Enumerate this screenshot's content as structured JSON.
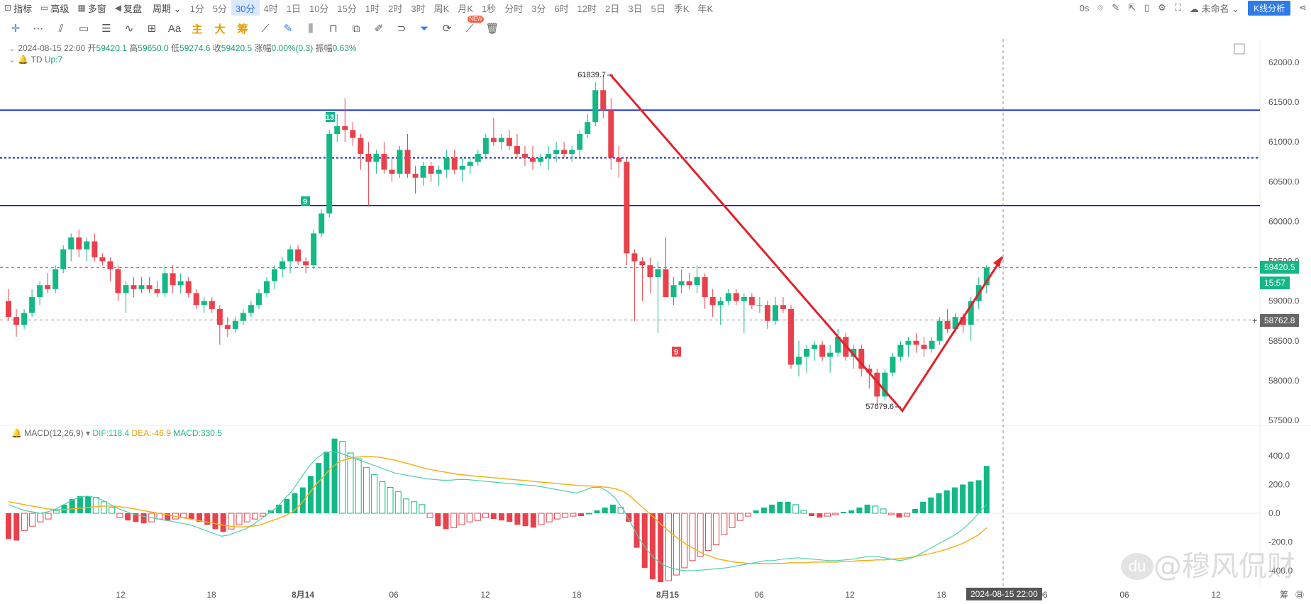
{
  "toolbar": {
    "left": [
      {
        "icon": "indicator-icon",
        "glyph": "⊡",
        "label": "指标"
      },
      {
        "icon": "advanced-icon",
        "glyph": "▭",
        "label": "高级"
      },
      {
        "icon": "multi-window-icon",
        "glyph": "▦",
        "label": "多窗"
      },
      {
        "icon": "replay-icon",
        "glyph": "◀",
        "label": "复盘"
      },
      {
        "icon": "chevron-down-icon",
        "glyph": "",
        "label": "周期 ⌄"
      }
    ],
    "periods": [
      "1分",
      "5分",
      "30分",
      "4时",
      "1日",
      "10分",
      "15分",
      "1时",
      "2时",
      "3时",
      "周K",
      "月K",
      "1秒",
      "分时",
      "3分",
      "6时",
      "12时",
      "2日",
      "3日",
      "5日",
      "季K",
      "年K"
    ],
    "active_period": "30分",
    "right": {
      "latency": "0s",
      "layout_name": "未命名",
      "kline_button": "K线分析"
    }
  },
  "tools": [
    {
      "name": "crosshair-icon",
      "glyph": "✛",
      "hl": true
    },
    {
      "name": "line-tools-icon",
      "glyph": "⋯"
    },
    {
      "name": "parallel-lines-icon",
      "glyph": "⫽"
    },
    {
      "name": "rectangle-icon",
      "glyph": "▭"
    },
    {
      "name": "horizontal-lines-icon",
      "glyph": "☰"
    },
    {
      "name": "wave-icon",
      "glyph": "∿"
    },
    {
      "name": "measure-icon",
      "glyph": "⊞"
    },
    {
      "name": "text-icon",
      "glyph": "Aa"
    },
    {
      "name": "main-force-icon",
      "glyph": "主",
      "zh": true,
      "color": "#e0a000"
    },
    {
      "name": "large-order-icon",
      "glyph": "大",
      "zh": true,
      "color": "#e0a000"
    },
    {
      "name": "chip-icon",
      "glyph": "筹",
      "zh": true,
      "color": "#e0a000"
    },
    {
      "name": "ruler-icon",
      "glyph": "⟋"
    },
    {
      "name": "pen-icon",
      "glyph": "✎",
      "hl": true
    },
    {
      "name": "candle-icon",
      "glyph": "⫼"
    },
    {
      "name": "lock-icon",
      "glyph": "⊓"
    },
    {
      "name": "copy-icon",
      "glyph": "⧉"
    },
    {
      "name": "edit-icon",
      "glyph": "✐"
    },
    {
      "name": "magnet-icon",
      "glyph": "⊃"
    },
    {
      "name": "filter-icon",
      "glyph": "⏷",
      "hl": true
    },
    {
      "name": "sync-icon",
      "glyph": "⟳"
    },
    {
      "name": "drawing-new-icon",
      "glyph": "⟋",
      "badge": "NEW"
    },
    {
      "name": "trash-icon",
      "glyph": "🗑"
    }
  ],
  "bar_info": {
    "date": "2024-08-15 22:00",
    "open_label": "开",
    "open": "59420.1",
    "high_label": "高",
    "high": "59650.0",
    "low_label": "低",
    "low": "59274.6",
    "close_label": "收",
    "close": "59420.5",
    "change_label": "涨幅",
    "change": "0.00%(0.3)",
    "amp_label": "振幅",
    "amp": "0.63%"
  },
  "td_indicator": {
    "name": "TD",
    "value": "Up:7"
  },
  "macd_info": {
    "name": "MACD(12,26,9)",
    "dif": "DIF:118.4",
    "dea": "DEA:-46.9",
    "macd": "MACD:330.5"
  },
  "price_tags": {
    "last": "59420.5",
    "countdown": "15:57",
    "cursor": "58762.8"
  },
  "crosshair_time": "2024-08-15 22:00",
  "watermark": "@穆风侃财",
  "colors": {
    "up": "#13b886",
    "down": "#e8414c",
    "hline": "#1b32c8",
    "annotation": "#e3202a",
    "dif": "#4fcfb0",
    "dea": "#f4b11c"
  },
  "chart_data": {
    "type": "candlestick",
    "symbol_interval": "30分",
    "y_axis": {
      "min": 57500,
      "max": 62000,
      "ticks": [
        62000.0,
        61500.0,
        61000.0,
        60500.0,
        60000.0,
        59500.0,
        59000.0,
        58500.0,
        58000.0,
        57500.0
      ]
    },
    "x_axis": {
      "ticks": [
        "12",
        "18",
        "8月14",
        "06",
        "12",
        "18",
        "8月15",
        "06",
        "12",
        "18",
        "06",
        "06",
        "12"
      ]
    },
    "candles": [
      [
        59000,
        59150,
        58750,
        58800
      ],
      [
        58800,
        58900,
        58550,
        58700
      ],
      [
        58700,
        58900,
        58650,
        58850
      ],
      [
        58850,
        59150,
        58800,
        59050
      ],
      [
        59050,
        59250,
        58950,
        59200
      ],
      [
        59200,
        59350,
        59100,
        59150
      ],
      [
        59150,
        59450,
        59100,
        59400
      ],
      [
        59400,
        59700,
        59350,
        59650
      ],
      [
        59650,
        59850,
        59500,
        59800
      ],
      [
        59800,
        59900,
        59550,
        59650
      ],
      [
        59650,
        59800,
        59500,
        59750
      ],
      [
        59750,
        59850,
        59500,
        59550
      ],
      [
        59550,
        59600,
        59450,
        59500
      ],
      [
        59500,
        59550,
        59250,
        59400
      ],
      [
        59400,
        59450,
        59000,
        59100
      ],
      [
        59100,
        59250,
        58850,
        59200
      ],
      [
        59200,
        59300,
        59050,
        59150
      ],
      [
        59150,
        59300,
        59100,
        59200
      ],
      [
        59200,
        59300,
        59100,
        59150
      ],
      [
        59150,
        59250,
        59050,
        59100
      ],
      [
        59100,
        59450,
        59050,
        59350
      ],
      [
        59350,
        59450,
        59100,
        59200
      ],
      [
        59200,
        59350,
        59100,
        59250
      ],
      [
        59250,
        59300,
        59050,
        59100
      ],
      [
        59100,
        59150,
        58900,
        58950
      ],
      [
        58950,
        59050,
        58850,
        59000
      ],
      [
        59000,
        59050,
        58850,
        58900
      ],
      [
        58900,
        58950,
        58450,
        58700
      ],
      [
        58700,
        58800,
        58550,
        58650
      ],
      [
        58650,
        58800,
        58600,
        58750
      ],
      [
        58750,
        58900,
        58700,
        58850
      ],
      [
        58850,
        59000,
        58800,
        58950
      ],
      [
        58950,
        59150,
        58900,
        59100
      ],
      [
        59100,
        59300,
        59050,
        59250
      ],
      [
        59250,
        59450,
        59150,
        59400
      ],
      [
        59400,
        59550,
        59300,
        59500
      ],
      [
        59500,
        59700,
        59350,
        59650
      ],
      [
        59650,
        59700,
        59450,
        59500
      ],
      [
        59500,
        59550,
        59350,
        59450
      ],
      [
        59450,
        59900,
        59400,
        59850
      ],
      [
        59850,
        60150,
        59800,
        60100
      ],
      [
        60100,
        61150,
        60050,
        61100
      ],
      [
        61100,
        61350,
        61000,
        61200
      ],
      [
        61200,
        61550,
        61000,
        61150
      ],
      [
        61150,
        61250,
        60950,
        61050
      ],
      [
        61050,
        61100,
        60650,
        60850
      ],
      [
        60850,
        61000,
        60200,
        60750
      ],
      [
        60750,
        60900,
        60600,
        60850
      ],
      [
        60850,
        61000,
        60600,
        60650
      ],
      [
        60650,
        60800,
        60500,
        60600
      ],
      [
        60600,
        60950,
        60550,
        60900
      ],
      [
        60900,
        61100,
        60550,
        60600
      ],
      [
        60600,
        60700,
        60350,
        60550
      ],
      [
        60550,
        60750,
        60450,
        60700
      ],
      [
        60700,
        60750,
        60500,
        60600
      ],
      [
        60600,
        60700,
        60450,
        60650
      ],
      [
        60650,
        60900,
        60550,
        60800
      ],
      [
        60800,
        60900,
        60600,
        60650
      ],
      [
        60650,
        60800,
        60500,
        60700
      ],
      [
        60700,
        60800,
        60600,
        60750
      ],
      [
        60750,
        60900,
        60700,
        60850
      ],
      [
        60850,
        61100,
        60800,
        61050
      ],
      [
        61050,
        61300,
        60950,
        61000
      ],
      [
        61000,
        61100,
        60900,
        61050
      ],
      [
        61050,
        61150,
        60900,
        60950
      ],
      [
        60950,
        61100,
        60800,
        60850
      ],
      [
        60850,
        60950,
        60700,
        60800
      ],
      [
        60800,
        60950,
        60650,
        60750
      ],
      [
        60750,
        60850,
        60700,
        60800
      ],
      [
        60800,
        60950,
        60650,
        60850
      ],
      [
        60850,
        61000,
        60750,
        60900
      ],
      [
        60900,
        61000,
        60800,
        60850
      ],
      [
        60850,
        60950,
        60750,
        60900
      ],
      [
        60900,
        61150,
        60800,
        61100
      ],
      [
        61100,
        61350,
        61050,
        61250
      ],
      [
        61250,
        61750,
        61200,
        61650
      ],
      [
        61650,
        61840,
        61300,
        61400
      ],
      [
        61400,
        61550,
        60650,
        60800
      ],
      [
        60800,
        60950,
        60550,
        60750
      ],
      [
        60750,
        60800,
        59450,
        59600
      ],
      [
        59600,
        59650,
        58750,
        59500
      ],
      [
        59500,
        59550,
        59000,
        59450
      ],
      [
        59450,
        59550,
        59100,
        59300
      ],
      [
        59300,
        59500,
        58600,
        59400
      ],
      [
        59400,
        59800,
        59100,
        59050
      ],
      [
        59050,
        59300,
        58950,
        59200
      ],
      [
        59200,
        59400,
        59100,
        59250
      ],
      [
        59250,
        59350,
        59150,
        59200
      ],
      [
        59200,
        59450,
        59100,
        59300
      ],
      [
        59300,
        59350,
        58900,
        59050
      ],
      [
        59050,
        59150,
        58800,
        58950
      ],
      [
        58950,
        59050,
        58700,
        59000
      ],
      [
        59000,
        59150,
        58950,
        59100
      ],
      [
        59100,
        59150,
        58950,
        59000
      ],
      [
        59000,
        59100,
        58600,
        59050
      ],
      [
        59050,
        59100,
        58900,
        58950
      ],
      [
        58950,
        59050,
        58850,
        58950
      ],
      [
        58950,
        59000,
        58650,
        58750
      ],
      [
        58750,
        59050,
        58700,
        58950
      ],
      [
        58950,
        59050,
        58850,
        58900
      ],
      [
        58900,
        58950,
        58150,
        58200
      ],
      [
        58200,
        58500,
        58050,
        58300
      ],
      [
        58300,
        58450,
        58100,
        58400
      ],
      [
        58400,
        58500,
        58250,
        58450
      ],
      [
        58450,
        58500,
        58250,
        58300
      ],
      [
        58300,
        58450,
        58100,
        58350
      ],
      [
        58350,
        58650,
        58300,
        58550
      ],
      [
        58550,
        58600,
        58250,
        58300
      ],
      [
        58300,
        58450,
        58150,
        58400
      ],
      [
        58400,
        58450,
        58050,
        58150
      ],
      [
        58150,
        58200,
        57900,
        58100
      ],
      [
        58100,
        58150,
        57680,
        57800
      ],
      [
        57800,
        58150,
        57750,
        58100
      ],
      [
        58100,
        58350,
        58050,
        58300
      ],
      [
        58300,
        58500,
        58250,
        58450
      ],
      [
        58450,
        58550,
        58300,
        58500
      ],
      [
        58500,
        58600,
        58350,
        58450
      ],
      [
        58450,
        58550,
        58300,
        58400
      ],
      [
        58400,
        58550,
        58350,
        58500
      ],
      [
        58500,
        58800,
        58450,
        58750
      ],
      [
        58750,
        58900,
        58600,
        58650
      ],
      [
        58650,
        58850,
        58600,
        58800
      ],
      [
        58800,
        58850,
        58600,
        58700
      ],
      [
        58700,
        59050,
        58500,
        59000
      ],
      [
        59000,
        59300,
        58900,
        59200
      ],
      [
        59200,
        59450,
        59100,
        59420
      ]
    ],
    "horizontal_lines": [
      61400,
      60800,
      60200
    ],
    "dashed_lines": [
      {
        "value": 59420.5,
        "color": "#13b886"
      },
      {
        "value": 58762.8,
        "color": "#999999"
      }
    ],
    "annotations": {
      "high_label": "61839.7",
      "low_label": "57679.6",
      "td_counts": [
        "13",
        "9",
        "9"
      ],
      "arrow_path": [
        61850,
        57620,
        59550
      ]
    },
    "macd": {
      "axis_ticks": [
        "400.0",
        "200.0",
        "0.0",
        "-200.0",
        "-400.0"
      ],
      "range": [
        -500,
        500
      ],
      "hist": [
        -180,
        -190,
        -120,
        -90,
        -60,
        -40,
        20,
        60,
        100,
        120,
        120,
        110,
        80,
        40,
        -30,
        -50,
        -60,
        -70,
        -60,
        -40,
        -50,
        -40,
        -30,
        -40,
        -60,
        -80,
        -110,
        -130,
        -110,
        -80,
        -60,
        -40,
        -20,
        20,
        60,
        100,
        140,
        180,
        260,
        350,
        430,
        520,
        500,
        420,
        380,
        320,
        270,
        220,
        180,
        150,
        100,
        80,
        60,
        -30,
        -90,
        -110,
        -100,
        -80,
        -60,
        -50,
        -30,
        -40,
        -50,
        -60,
        -80,
        -90,
        -100,
        -80,
        -60,
        -40,
        -30,
        -20,
        -20,
        0,
        20,
        40,
        60,
        40,
        -60,
        -240,
        -380,
        -460,
        -480,
        -470,
        -430,
        -380,
        -330,
        -300,
        -260,
        -220,
        -150,
        -100,
        -50,
        -20,
        20,
        40,
        60,
        80,
        80,
        60,
        20,
        -20,
        -30,
        -20,
        -10,
        10,
        20,
        40,
        60,
        50,
        30,
        -10,
        -30,
        -20,
        30,
        80,
        110,
        140,
        160,
        180,
        200,
        220,
        230,
        330
      ],
      "dif": [
        60,
        40,
        20,
        10,
        0,
        10,
        30,
        60,
        90,
        110,
        120,
        110,
        90,
        60,
        30,
        10,
        -10,
        -20,
        -30,
        -40,
        -50,
        -60,
        -70,
        -80,
        -100,
        -120,
        -140,
        -160,
        -150,
        -130,
        -110,
        -80,
        -40,
        0,
        40,
        100,
        160,
        240,
        320,
        380,
        420,
        430,
        420,
        400,
        380,
        360,
        340,
        320,
        300,
        280,
        270,
        260,
        250,
        240,
        235,
        230,
        230,
        235,
        235,
        230,
        225,
        220,
        215,
        210,
        205,
        200,
        195,
        190,
        180,
        170,
        160,
        150,
        140,
        160,
        180,
        180,
        150,
        100,
        20,
        -80,
        -180,
        -260,
        -320,
        -360,
        -380,
        -395,
        -400,
        -400,
        -395,
        -390,
        -385,
        -380,
        -370,
        -360,
        -350,
        -340,
        -330,
        -330,
        -320,
        -315,
        -310,
        -315,
        -320,
        -325,
        -330,
        -330,
        -325,
        -320,
        -310,
        -300,
        -300,
        -310,
        -320,
        -330,
        -320,
        -300,
        -270,
        -240,
        -210,
        -180,
        -150,
        -110,
        -60,
        0,
        60
      ],
      "dea": [
        80,
        70,
        60,
        50,
        40,
        30,
        25,
        25,
        30,
        35,
        40,
        45,
        50,
        50,
        45,
        40,
        30,
        20,
        10,
        0,
        -10,
        -20,
        -30,
        -40,
        -50,
        -60,
        -70,
        -80,
        -90,
        -95,
        -95,
        -90,
        -80,
        -60,
        -40,
        -20,
        10,
        60,
        130,
        200,
        260,
        320,
        360,
        380,
        390,
        395,
        395,
        390,
        380,
        370,
        355,
        340,
        325,
        310,
        300,
        290,
        280,
        270,
        265,
        260,
        255,
        250,
        245,
        240,
        235,
        230,
        225,
        220,
        215,
        210,
        205,
        200,
        195,
        190,
        190,
        185,
        180,
        170,
        150,
        110,
        60,
        10,
        -40,
        -90,
        -140,
        -180,
        -220,
        -250,
        -280,
        -300,
        -320,
        -330,
        -340,
        -345,
        -350,
        -350,
        -350,
        -350,
        -350,
        -345,
        -345,
        -345,
        -340,
        -340,
        -340,
        -340,
        -335,
        -335,
        -330,
        -330,
        -325,
        -325,
        -320,
        -315,
        -310,
        -300,
        -290,
        -280,
        -265,
        -250,
        -230,
        -210,
        -180,
        -150,
        -100
      ]
    }
  }
}
